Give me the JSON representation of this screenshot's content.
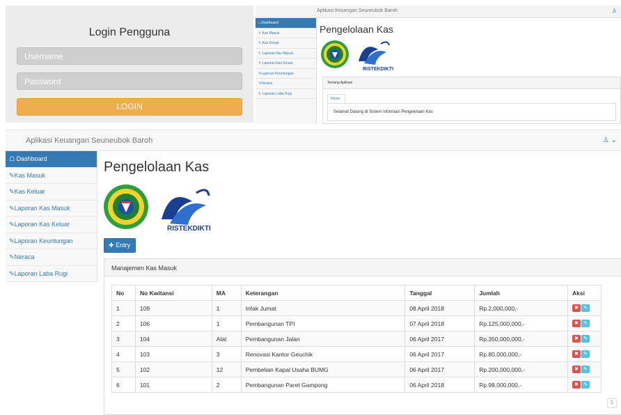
{
  "login": {
    "title": "Login Pengguna",
    "username_placeholder": "Username",
    "password_placeholder": "Password",
    "login_label": "LOGIN"
  },
  "mini": {
    "app_title": "Aplikasi Keuangan Seuneubok Baroh",
    "page_title": "Pengelolaan Kas",
    "menu": [
      "Dashboard",
      "Kas Masuk",
      "Kas Keluar",
      "Laporan Kas Masuk",
      "Laporan Kas Keluar",
      "Laporan Keuntungan",
      "Neraca",
      "Laporan Laba Rugi"
    ],
    "panel_title": "Tentang Aplikasi",
    "tab_label": "Home",
    "welcome_text": "Selamat Datang di Sistem Informasi Pengelolaan Kas",
    "logo_text": "RISTEKDIKTI"
  },
  "main": {
    "app_title": "Aplikasi Keuangan Seuneubok Baroh",
    "page_title": "Pengelolaan Kas",
    "logo_text": "RISTEKDIKTI",
    "menu": [
      "Dashboard",
      "Kas Masuk",
      "Kas Keluar",
      "Laporan Kas Masuk",
      "Laporan Kas Keluar",
      "Laporan Keuntungan",
      "Neraca",
      "Laporan Laba Rugi"
    ],
    "entry_label": "Entry",
    "panel_title": "Manajemen Kas Masuk",
    "columns": [
      "No",
      "No Kwitansi",
      "MA",
      "Keterangan",
      "Tanggal",
      "Jumlah",
      "Aksi"
    ],
    "rows": [
      [
        "1",
        "109",
        "1",
        "Infak Jumat",
        "08 April 2018",
        "Rp.2,000,000,-"
      ],
      [
        "2",
        "106",
        "1",
        "Pembangunan TPI",
        "07 April 2018",
        "Rp.125,000,000,-"
      ],
      [
        "3",
        "104",
        "Alat",
        "Pembangunan Jalan",
        "06 April 2017",
        "Rp.350,000,000,-"
      ],
      [
        "4",
        "103",
        "3",
        "Renovasi Kantor Geuchik",
        "06 April 2017",
        "Rp.80,000,000,-"
      ],
      [
        "5",
        "102",
        "12",
        "Pembelian Kapal Usaha BUMG",
        "06 April 2017",
        "Rp.200,000,000,-"
      ],
      [
        "6",
        "101",
        "2",
        "Pembangunan Paret Gampong",
        "06 April 2018",
        "Rp.98,000,000,-"
      ]
    ],
    "page_number": "1"
  }
}
